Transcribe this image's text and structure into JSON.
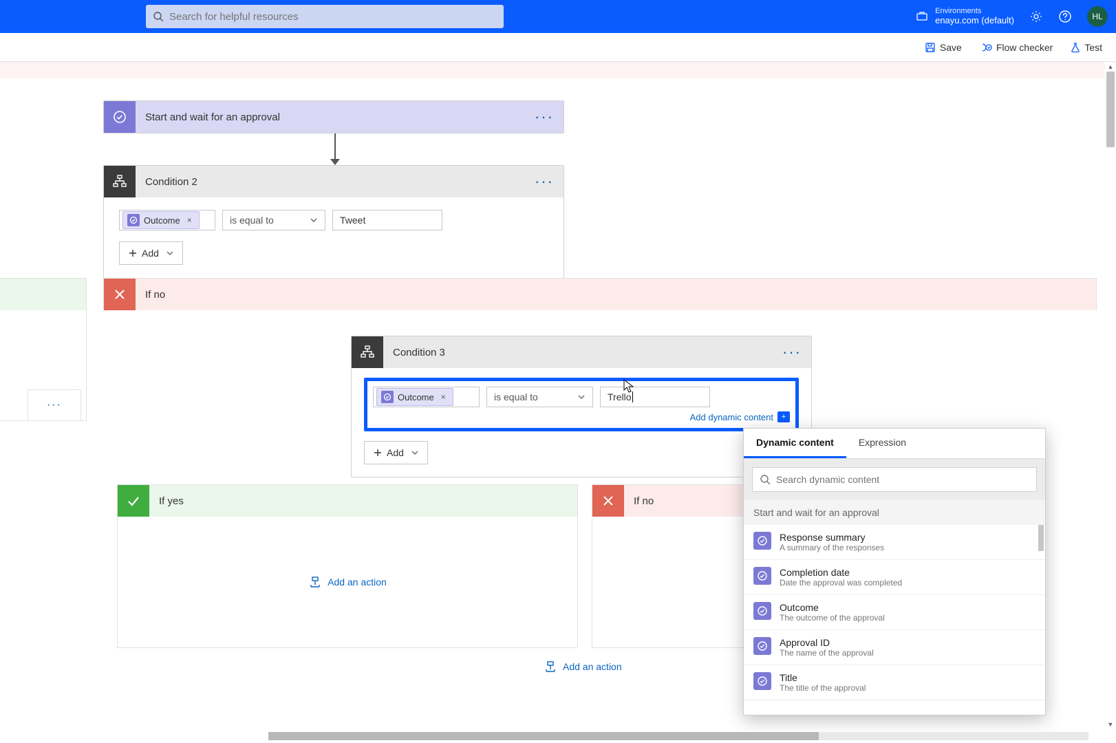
{
  "topbar": {
    "search_placeholder": "Search for helpful resources",
    "env_label": "Environments",
    "env_name": "enayu.com (default)",
    "avatar_initials": "HL"
  },
  "cmdbar": {
    "save": "Save",
    "flow_checker": "Flow checker",
    "test": "Test"
  },
  "approval_card": {
    "title": "Start and wait for an approval"
  },
  "condition2": {
    "title": "Condition 2",
    "token_label": "Outcome",
    "operator": "is equal to",
    "value": "Tweet",
    "add_label": "Add"
  },
  "outer_ifno": {
    "title": "If no"
  },
  "condition3": {
    "title": "Condition 3",
    "token_label": "Outcome",
    "operator": "is equal to",
    "value": "Trello",
    "dyn_link": "Add dynamic content",
    "add_label": "Add"
  },
  "branches": {
    "yes_title": "If yes",
    "no_title": "If no",
    "add_action": "Add an action",
    "add_action_bottom": "Add an action"
  },
  "popup": {
    "tab_dynamic": "Dynamic content",
    "tab_expression": "Expression",
    "search_placeholder": "Search dynamic content",
    "group": "Start and wait for an approval",
    "items": [
      {
        "t1": "Response summary",
        "t2": "A summary of the responses"
      },
      {
        "t1": "Completion date",
        "t2": "Date the approval was completed"
      },
      {
        "t1": "Outcome",
        "t2": "The outcome of the approval"
      },
      {
        "t1": "Approval ID",
        "t2": "The name of the approval"
      },
      {
        "t1": "Title",
        "t2": "The title of the approval"
      }
    ]
  }
}
